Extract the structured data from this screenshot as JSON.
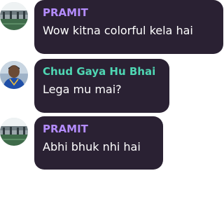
{
  "messages": [
    {
      "author": "PRAMIT",
      "author_color": "#b48cff",
      "text": "Wow kitna colorful kela hai",
      "avatar_icon": "stadium-avatar-icon"
    },
    {
      "author": "Chud Gaya Hu Bhai",
      "author_color": "#4fd6b3",
      "text": "Lega mu mai?",
      "avatar_icon": "cricketer-avatar-icon"
    },
    {
      "author": "PRAMIT",
      "author_color": "#b48cff",
      "text": "Abhi bhuk nhi hai",
      "avatar_icon": "stadium-avatar-icon"
    }
  ],
  "colors": {
    "bubble_bg": "#2a2133",
    "message_text": "#ffffff",
    "page_bg": "#ffffff"
  }
}
